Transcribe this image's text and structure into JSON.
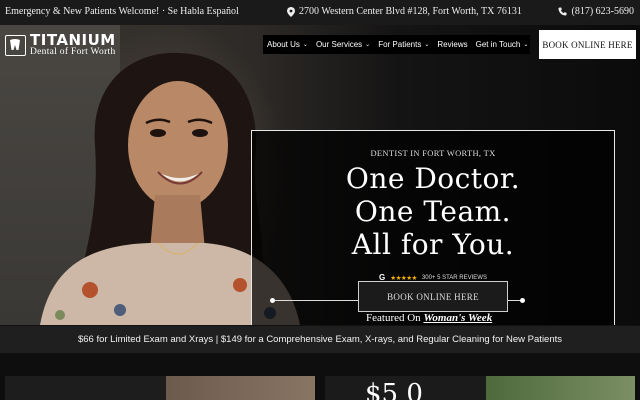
{
  "topbar": {
    "left_text": "Emergency & New Patients Welcome! · Se Habla Español",
    "address": "2700 Western Center Blvd #128, Fort Worth, TX 76131",
    "phone": "(817) 623-5690"
  },
  "logo": {
    "main": "TITANIUM",
    "sub": "Dental of Fort Worth"
  },
  "nav": {
    "items": [
      {
        "label": "About Us",
        "chevron": true
      },
      {
        "label": "Our Services",
        "chevron": true
      },
      {
        "label": "For Patients",
        "chevron": true
      },
      {
        "label": "Reviews",
        "chevron": false
      },
      {
        "label": "Get in Touch",
        "chevron": true
      }
    ],
    "book_button": "BOOK ONLINE HERE"
  },
  "hero": {
    "eyebrow": "DENTIST IN FORT WORTH, TX",
    "headline_1": "One Doctor.",
    "headline_2": "One Team.",
    "headline_3": "All for You.",
    "google_letter": "G",
    "stars": "★★★★★",
    "reviews_text": "300+ 5 STAR REVIEWS",
    "cta": "BOOK ONLINE HERE",
    "featured_prefix": "Featured On",
    "featured_brand": "Woman's Week"
  },
  "promo": {
    "text": "$66 for Limited Exam and Xrays | $149 for a Comprehensive Exam, X-rays, and Regular Cleaning for New Patients"
  },
  "lower": {
    "panel_1_text": "",
    "panel_2_text": "$5 0"
  },
  "colors": {
    "star": "#f5b400",
    "topbar": "#1a1a1a",
    "nav": "#000000"
  }
}
